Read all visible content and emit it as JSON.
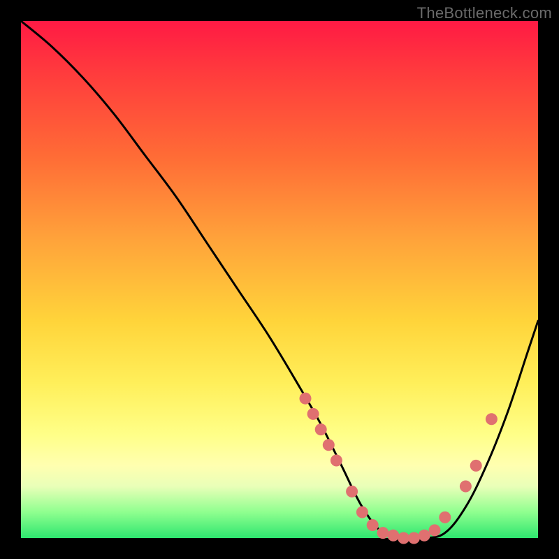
{
  "watermark": "TheBottleneck.com",
  "colors": {
    "curve_stroke": "#000000",
    "marker_fill": "#e07070",
    "background": "#000000",
    "gradient_top": "#ff1a44",
    "gradient_bottom": "#2ee66f"
  },
  "chart_data": {
    "type": "line",
    "title": "",
    "xlabel": "",
    "ylabel": "",
    "xlim": [
      0,
      100
    ],
    "ylim": [
      0,
      100
    ],
    "series": [
      {
        "name": "bottleneck-curve",
        "x": [
          0,
          6,
          12,
          18,
          24,
          30,
          36,
          42,
          48,
          54,
          58,
          62,
          66,
          70,
          74,
          78,
          82,
          86,
          90,
          94,
          98,
          100
        ],
        "y": [
          100,
          95,
          89,
          82,
          74,
          66,
          57,
          48,
          39,
          29,
          22,
          14,
          6,
          1,
          0,
          0,
          1,
          6,
          14,
          24,
          36,
          42
        ]
      }
    ],
    "markers": {
      "name": "highlighted-points",
      "x": [
        55,
        56.5,
        58,
        59.5,
        61,
        64,
        66,
        68,
        70,
        72,
        74,
        76,
        78,
        80,
        82,
        86,
        88,
        91
      ],
      "y": [
        27,
        24,
        21,
        18,
        15,
        9,
        5,
        2.5,
        1,
        0.5,
        0,
        0,
        0.5,
        1.5,
        4,
        10,
        14,
        23
      ]
    }
  }
}
